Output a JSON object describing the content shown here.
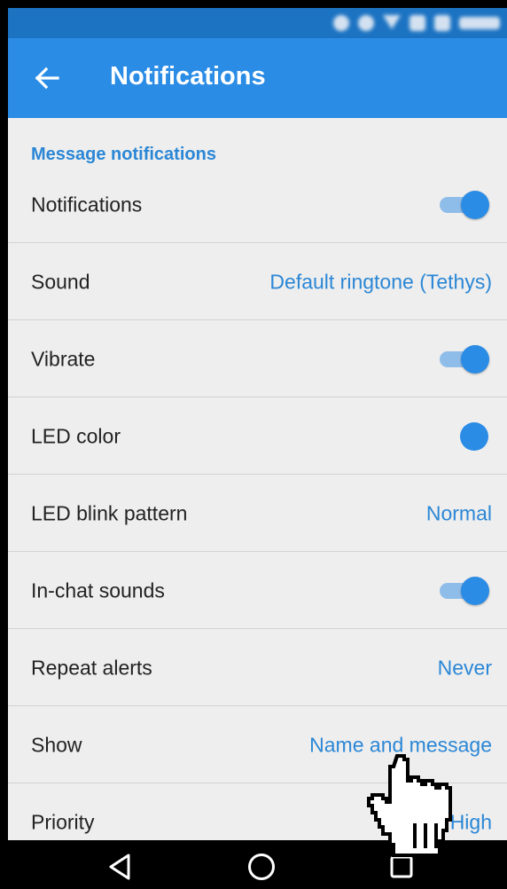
{
  "app_bar": {
    "title": "Notifications",
    "back_icon": "arrow-left-icon",
    "color": "#2b8ce6"
  },
  "status_bar": {
    "color": "#1c73c2"
  },
  "section": {
    "header": "Message notifications"
  },
  "settings": [
    {
      "label": "Notifications",
      "type": "toggle",
      "on": true
    },
    {
      "label": "Sound",
      "type": "value",
      "value": "Default ringtone (Tethys)"
    },
    {
      "label": "Vibrate",
      "type": "toggle",
      "on": true
    },
    {
      "label": "LED color",
      "type": "color",
      "color": "#2b8ce6"
    },
    {
      "label": "LED blink pattern",
      "type": "value",
      "value": "Normal"
    },
    {
      "label": "In-chat sounds",
      "type": "toggle",
      "on": true
    },
    {
      "label": "Repeat alerts",
      "type": "value",
      "value": "Never"
    },
    {
      "label": "Show",
      "type": "value",
      "value": "Name and message"
    },
    {
      "label": "Priority",
      "type": "value",
      "value": "High"
    }
  ],
  "nav_bar": {
    "back_icon": "triangle-back-icon",
    "home_icon": "circle-home-icon",
    "recents_icon": "square-recents-icon"
  },
  "accent_color": "#2b87d6"
}
